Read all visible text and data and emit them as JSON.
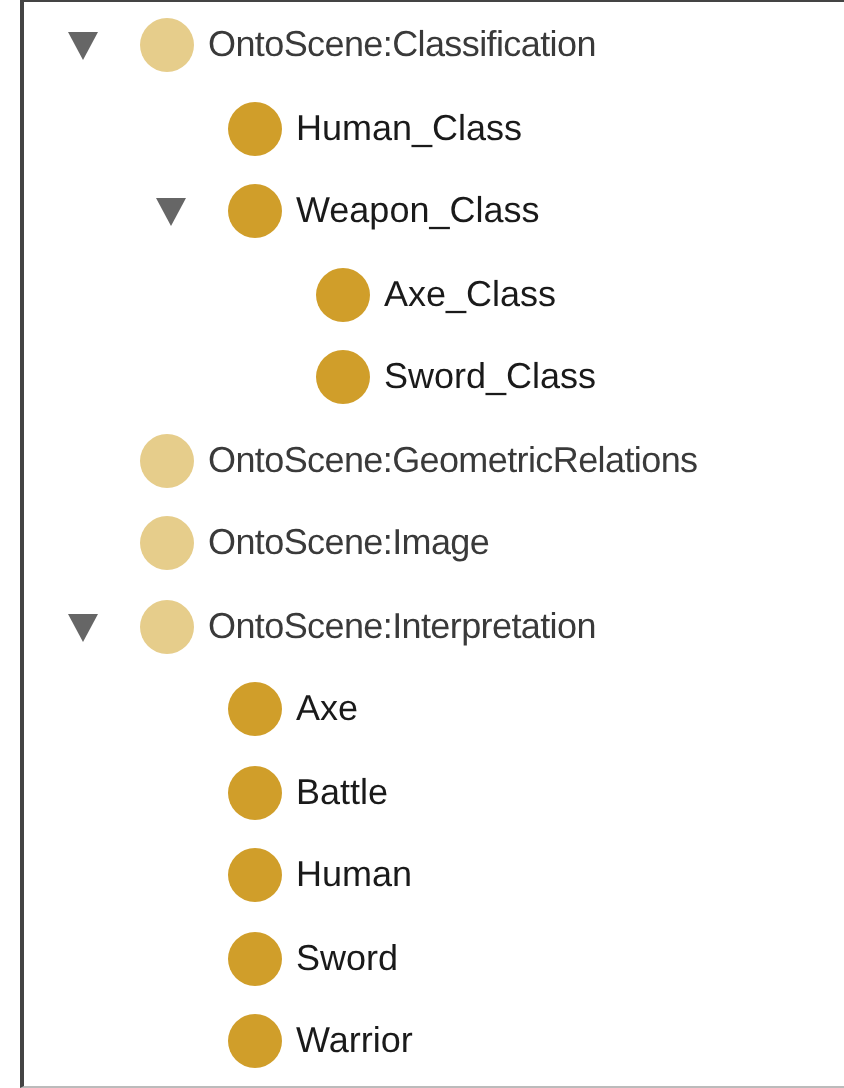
{
  "tree": [
    {
      "label": "OntoScene:Classification",
      "expanded": true,
      "children": [
        {
          "label": "Human_Class",
          "expanded": false
        },
        {
          "label": "Weapon_Class",
          "expanded": true,
          "children": [
            {
              "label": "Axe_Class",
              "expanded": false
            },
            {
              "label": "Sword_Class",
              "expanded": false
            }
          ]
        }
      ]
    },
    {
      "label": "OntoScene:GeometricRelations",
      "expanded": false
    },
    {
      "label": "OntoScene:Image",
      "expanded": false
    },
    {
      "label": "OntoScene:Interpretation",
      "expanded": true,
      "children": [
        {
          "label": "Axe",
          "expanded": false
        },
        {
          "label": "Battle",
          "expanded": false
        },
        {
          "label": "Human",
          "expanded": false
        },
        {
          "label": "Sword",
          "expanded": false
        },
        {
          "label": "Warrior",
          "expanded": false
        }
      ]
    }
  ]
}
